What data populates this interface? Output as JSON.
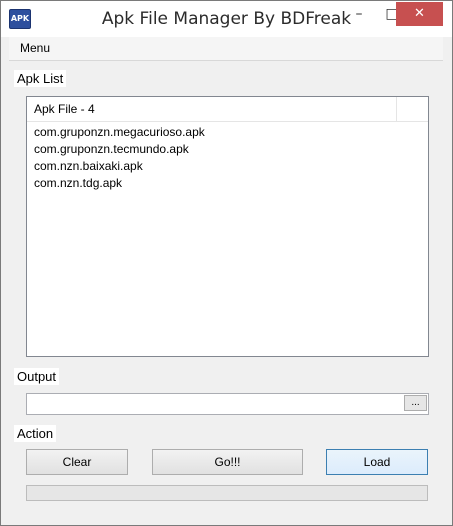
{
  "window": {
    "title": "Apk File Manager By BDFreak",
    "icon_name": "app-icon",
    "controls": {
      "minimize": "–",
      "maximize": "□",
      "close": "✕"
    }
  },
  "menubar": {
    "items": [
      {
        "label": "Menu"
      }
    ]
  },
  "apk_list": {
    "group_label": "Apk List",
    "column_header": "Apk File - 4",
    "items": [
      "com.gruponzn.megacurioso.apk",
      "com.gruponzn.tecmundo.apk",
      "com.nzn.baixaki.apk",
      "com.nzn.tdg.apk"
    ]
  },
  "output": {
    "group_label": "Output",
    "value": "",
    "browse_label": "..."
  },
  "action": {
    "group_label": "Action",
    "clear_label": "Clear",
    "go_label": "Go!!!",
    "load_label": "Load",
    "progress_percent": 0
  },
  "colors": {
    "close_button": "#c75050",
    "focus_border": "#3c7fb1",
    "progress_fill": "#06b025"
  }
}
